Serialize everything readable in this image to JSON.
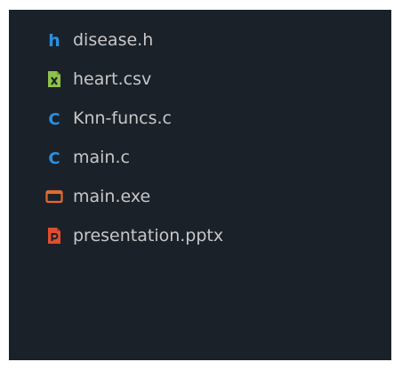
{
  "explorer": {
    "files": [
      {
        "name": "disease.h",
        "icon": "h-header-icon",
        "icon_color": "#2a8fe0"
      },
      {
        "name": "heart.csv",
        "icon": "csv-spreadsheet-icon",
        "icon_color": "#8dc149"
      },
      {
        "name": "Knn-funcs.c",
        "icon": "c-source-icon",
        "icon_color": "#2a8fe0"
      },
      {
        "name": "main.c",
        "icon": "c-source-icon",
        "icon_color": "#2a8fe0"
      },
      {
        "name": "main.exe",
        "icon": "executable-window-icon",
        "icon_color": "#e36a2e"
      },
      {
        "name": "presentation.pptx",
        "icon": "powerpoint-icon",
        "icon_color": "#e04e2f"
      }
    ]
  },
  "colors": {
    "panel_background": "#1b2129",
    "label_text": "#c7c7c7"
  }
}
